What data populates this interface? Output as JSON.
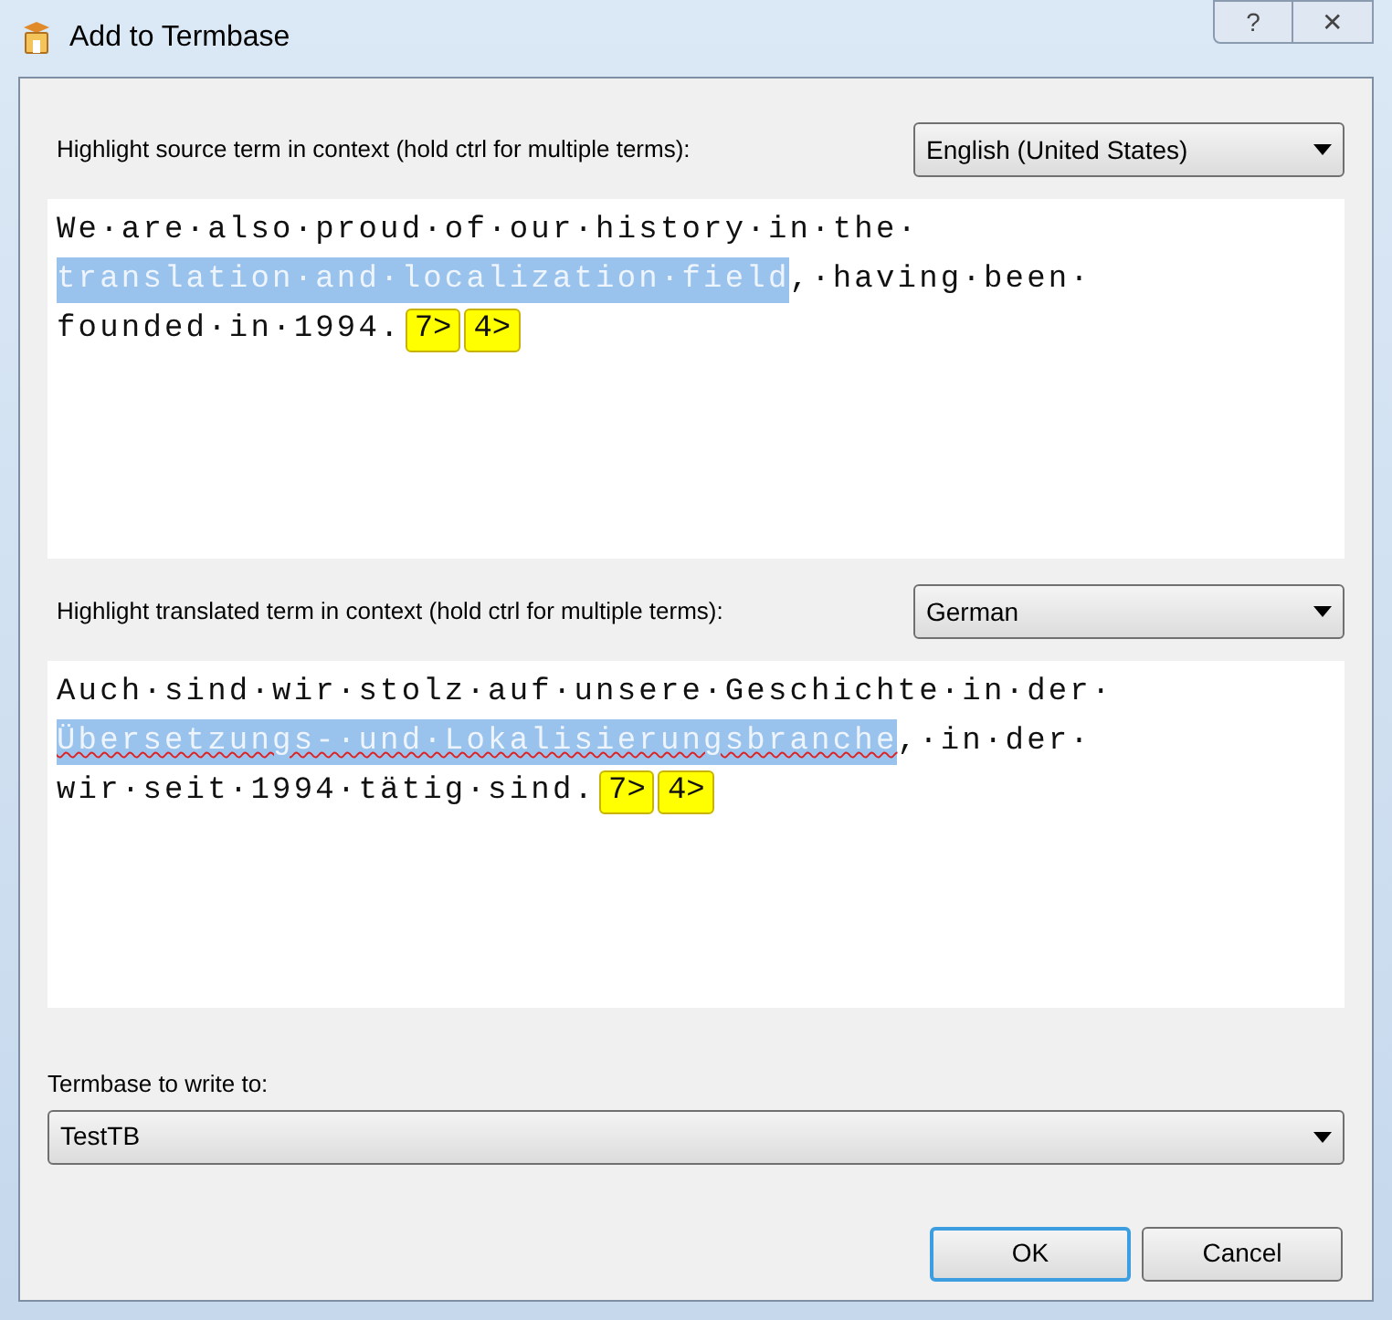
{
  "window": {
    "title": "Add to Termbase",
    "buttons": [
      "?",
      "✕"
    ]
  },
  "source": {
    "label": "Highlight source term in context (hold ctrl for multiple terms):",
    "language": "English (United States)",
    "lines": [
      [
        {
          "kind": "text",
          "text": "We·are·also·proud·of·our·history·in·the·",
          "highlighted": false,
          "spelling_error": false
        }
      ],
      [
        {
          "kind": "text",
          "text": "translation·and·localization·field",
          "highlighted": true,
          "spelling_error": false
        },
        {
          "kind": "text",
          "text": ",·having·been·",
          "highlighted": false,
          "spelling_error": false
        }
      ],
      [
        {
          "kind": "text",
          "text": "founded·in·1994.",
          "highlighted": false,
          "spelling_error": false
        },
        {
          "kind": "tag",
          "text": "7>"
        },
        {
          "kind": "tag",
          "text": "4>"
        }
      ]
    ]
  },
  "target": {
    "label": "Highlight translated term in context (hold ctrl for multiple terms):",
    "language": "German",
    "lines": [
      [
        {
          "kind": "text",
          "text": "Auch·sind·wir·stolz·auf·unsere·Geschichte·in·der·",
          "highlighted": false,
          "spelling_error": false
        }
      ],
      [
        {
          "kind": "text",
          "text": "Übersetzungs-·und·Lokalisierungsbranche",
          "highlighted": true,
          "spelling_error": true
        },
        {
          "kind": "text",
          "text": ",·in·der·",
          "highlighted": false,
          "spelling_error": false
        }
      ],
      [
        {
          "kind": "text",
          "text": "wir·seit·1994·tätig·sind.",
          "highlighted": false,
          "spelling_error": false
        },
        {
          "kind": "tag",
          "text": "7>"
        },
        {
          "kind": "tag",
          "text": "4>"
        }
      ]
    ]
  },
  "termbase": {
    "label": "Termbase to write to:",
    "value": "TestTB"
  },
  "buttons": [
    {
      "label": "OK",
      "default": true
    },
    {
      "label": "Cancel",
      "default": false
    }
  ]
}
